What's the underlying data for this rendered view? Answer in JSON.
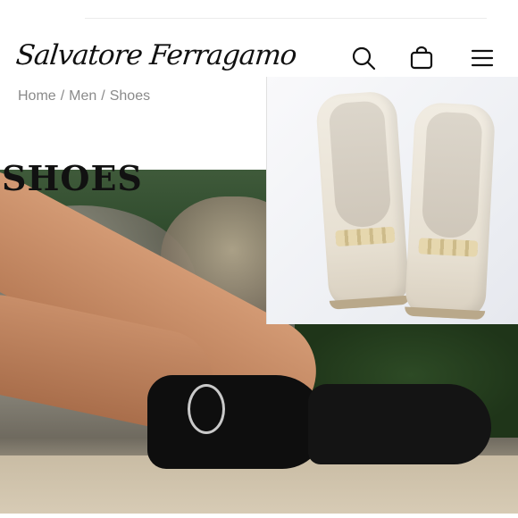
{
  "header": {
    "logo_text": "Salvatore Ferragamo",
    "icons": [
      "search-icon",
      "shopping-bag-icon",
      "menu-icon"
    ]
  },
  "breadcrumb": {
    "items": [
      "Home",
      "Men",
      "Shoes"
    ],
    "separator": "/"
  },
  "page": {
    "title": "SHOES"
  },
  "colors": {
    "text": "#111111",
    "breadcrumb": "#8a8a8a",
    "background": "#ffffff"
  }
}
